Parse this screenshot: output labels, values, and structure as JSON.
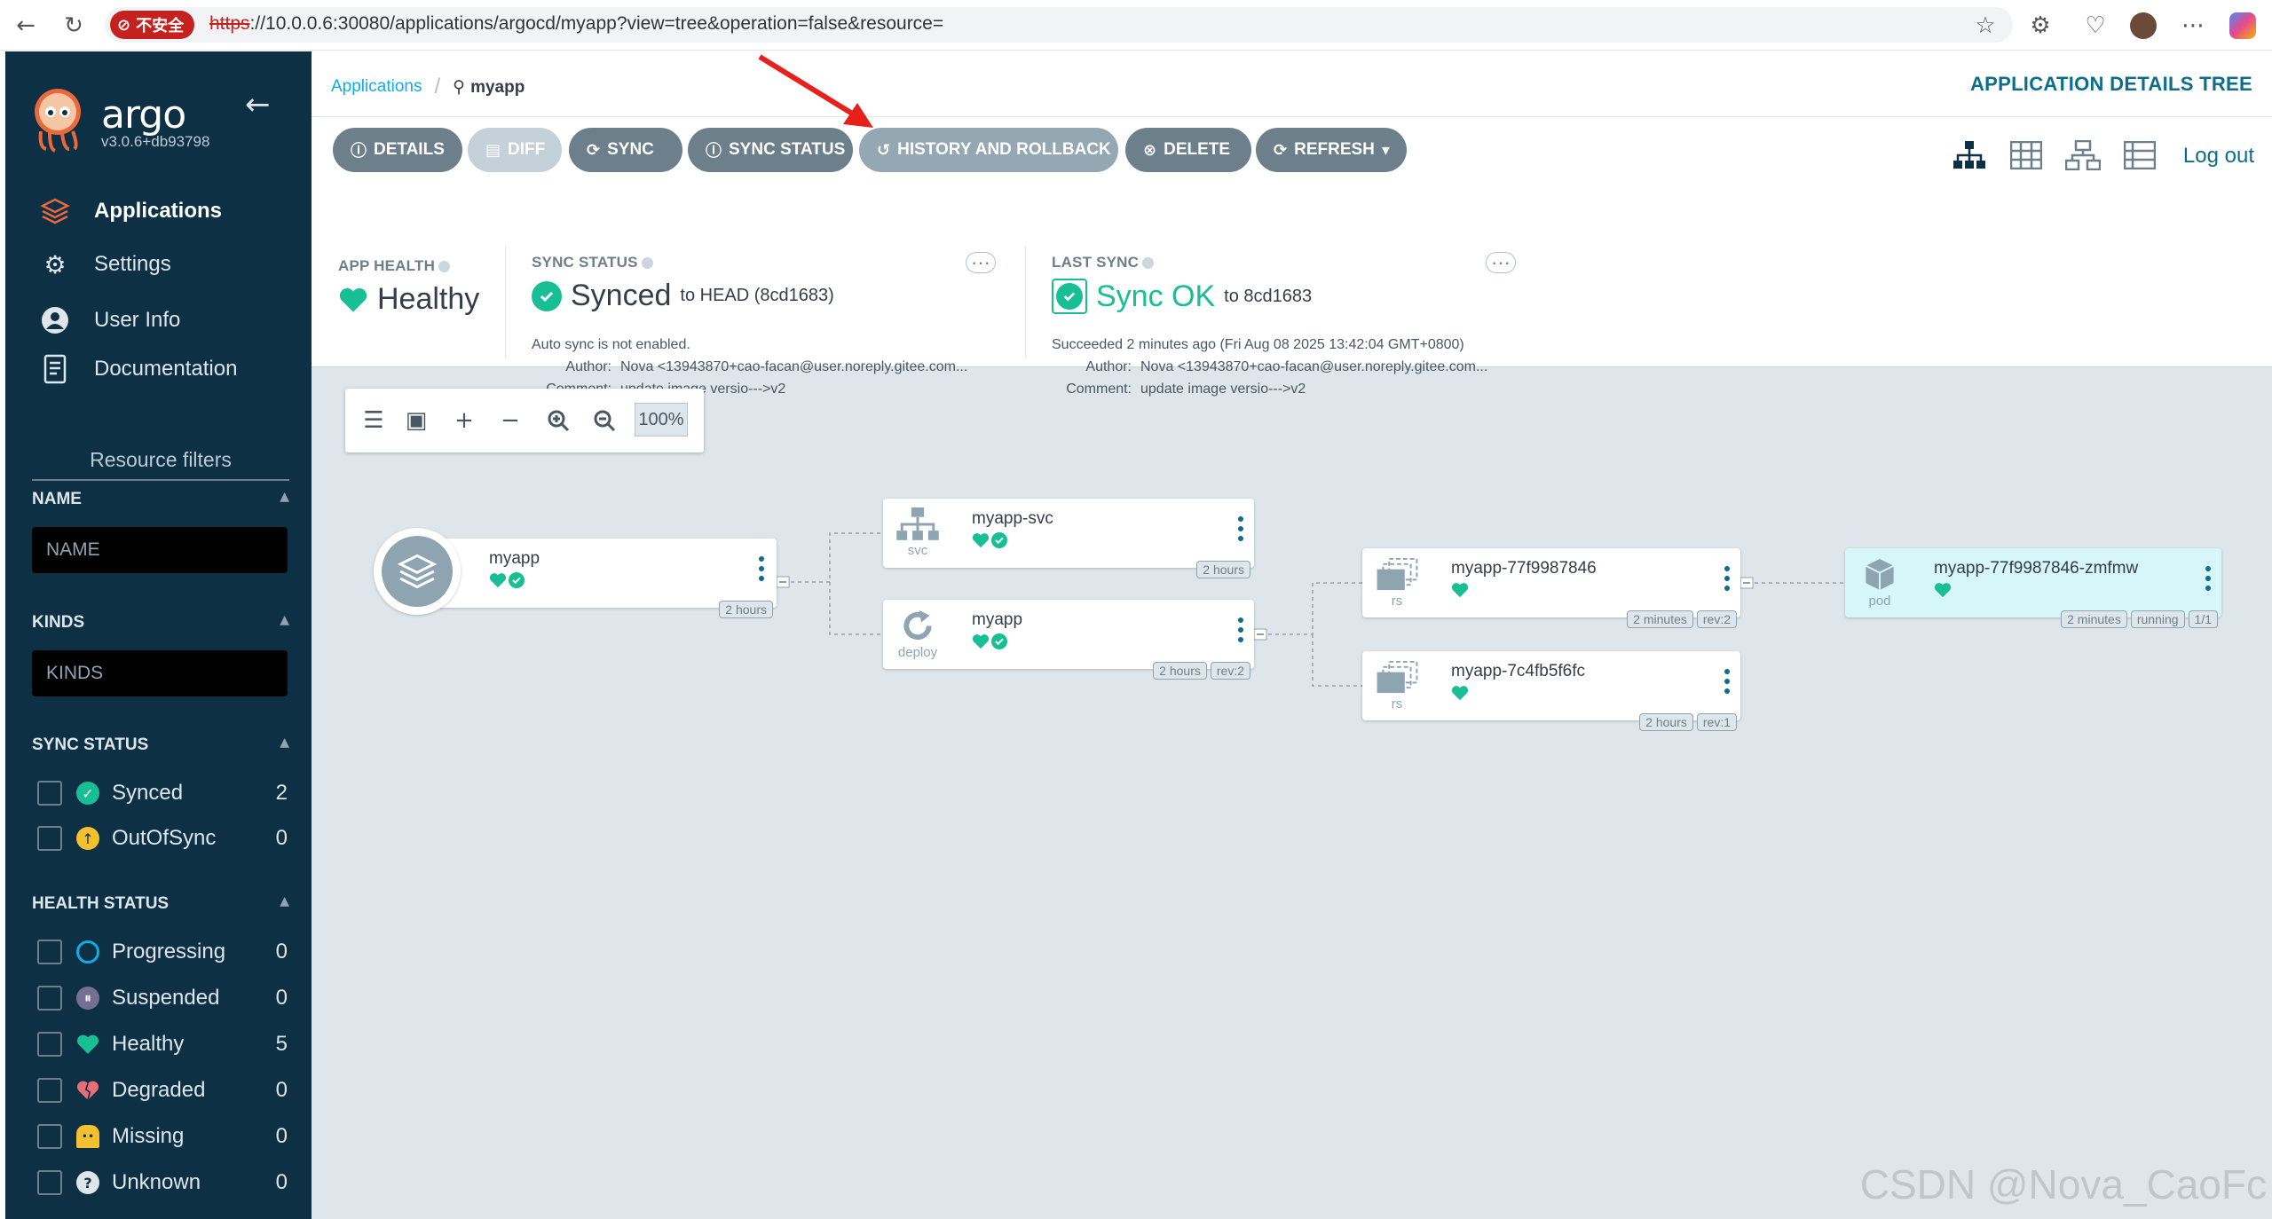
{
  "browser": {
    "insecure_label": "不安全",
    "url_scheme": "https",
    "url_rest": "://10.0.0.6:30080/applications/argocd/myapp?view=tree&operation=false&resource="
  },
  "sidebar": {
    "brand": "argo",
    "version": "v3.0.6+db93798",
    "nav": [
      {
        "label": "Applications",
        "icon": "layers-icon"
      },
      {
        "label": "Settings",
        "icon": "gear-icon"
      },
      {
        "label": "User Info",
        "icon": "user-icon"
      },
      {
        "label": "Documentation",
        "icon": "document-icon"
      }
    ],
    "filters_title": "Resource filters",
    "name_header": "NAME",
    "name_placeholder": "NAME",
    "kinds_header": "KINDS",
    "kinds_placeholder": "KINDS",
    "sync_header": "SYNC STATUS",
    "sync_items": [
      {
        "label": "Synced",
        "count": "2"
      },
      {
        "label": "OutOfSync",
        "count": "0"
      }
    ],
    "health_header": "HEALTH STATUS",
    "health_items": [
      {
        "label": "Progressing",
        "count": "0"
      },
      {
        "label": "Suspended",
        "count": "0"
      },
      {
        "label": "Healthy",
        "count": "5"
      },
      {
        "label": "Degraded",
        "count": "0"
      },
      {
        "label": "Missing",
        "count": "0"
      },
      {
        "label": "Unknown",
        "count": "0"
      }
    ]
  },
  "header": {
    "breadcrumb_root": "Applications",
    "breadcrumb_current": "myapp",
    "page_title": "APPLICATION DETAILS TREE",
    "logout": "Log out"
  },
  "actions": {
    "details": "DETAILS",
    "diff": "DIFF",
    "sync": "SYNC",
    "sync_status": "SYNC STATUS",
    "history": "HISTORY AND ROLLBACK",
    "delete": "DELETE",
    "refresh": "REFRESH"
  },
  "status": {
    "app_health_label": "APP HEALTH",
    "app_health_value": "Healthy",
    "sync_status_label": "SYNC STATUS",
    "sync_status_value": "Synced",
    "sync_to": "to HEAD (8cd1683)",
    "auto_sync": "Auto sync is not enabled.",
    "author_key": "Author:",
    "author_val": "Nova <13943870+cao-facan@user.noreply.gitee.com...",
    "comment_key": "Comment:",
    "comment_val": "update image versio--->v2",
    "last_sync_label": "LAST SYNC",
    "last_sync_value": "Sync OK",
    "last_sync_to": "to 8cd1683",
    "succeeded": "Succeeded 2 minutes ago (Fri Aug 08 2025 13:42:04 GMT+0800)",
    "ls_author_key": "Author:",
    "ls_author_val": "Nova <13943870+cao-facan@user.noreply.gitee.com...",
    "ls_comment_key": "Comment:",
    "ls_comment_val": "update image versio--->v2"
  },
  "zoom": {
    "level": "100%"
  },
  "nodes": {
    "app": {
      "name": "myapp",
      "tags": [
        "2 hours"
      ]
    },
    "svc": {
      "name": "myapp-svc",
      "kind": "svc",
      "tags": [
        "2 hours"
      ]
    },
    "deploy": {
      "name": "myapp",
      "kind": "deploy",
      "tags": [
        "2 hours",
        "rev:2"
      ]
    },
    "rs1": {
      "name": "myapp-77f9987846",
      "kind": "rs",
      "tags": [
        "2 minutes",
        "rev:2"
      ]
    },
    "rs2": {
      "name": "myapp-7c4fb5f6fc",
      "kind": "rs",
      "tags": [
        "2 hours",
        "rev:1"
      ]
    },
    "pod": {
      "name": "myapp-77f9987846-zmfmw",
      "kind": "pod",
      "tags": [
        "2 minutes",
        "running",
        "1/1"
      ]
    }
  },
  "watermark": "CSDN @Nova_CaoFc",
  "colors": {
    "sidebar": "#0d3045",
    "accent": "#0c6d8c",
    "healthy": "#18be94",
    "button": "#6d7f8b"
  }
}
